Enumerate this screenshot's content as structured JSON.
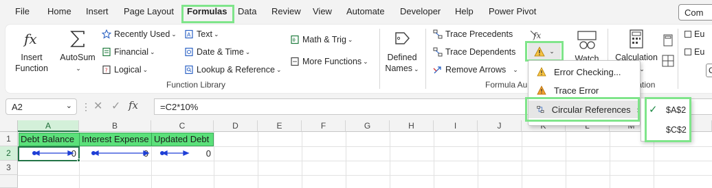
{
  "menu": {
    "tabs": [
      "File",
      "Home",
      "Insert",
      "Page Layout",
      "Formulas",
      "Data",
      "Review",
      "View",
      "Automate",
      "Developer",
      "Help",
      "Power Pivot"
    ],
    "active_tab": "Formulas",
    "comments_label": "Com"
  },
  "ribbon": {
    "insert_function": [
      "Insert",
      "Function"
    ],
    "autosum": "AutoSum",
    "recently_used": "Recently Used",
    "financial": "Financial",
    "logical": "Logical",
    "text": "Text",
    "date_time": "Date & Time",
    "lookup_reference": "Lookup & Reference",
    "math_trig": "Math & Trig",
    "more_functions": "More Functions",
    "function_library_label": "Function Library",
    "defined_names": [
      "Defined",
      "Names"
    ],
    "trace_precedents": "Trace Precedents",
    "trace_dependents": "Trace Dependents",
    "remove_arrows": "Remove Arrows",
    "formula_auditing_label": "Formula Au",
    "watch": "Watch",
    "calculation": "Calculation",
    "calculation_options_tail": "ns",
    "calculation_label": "ulation",
    "eu1": "Eu",
    "eu2": "Eu"
  },
  "error_dropdown": {
    "items": [
      "Error Checking...",
      "Trace Error",
      "Circular References"
    ]
  },
  "circular_submenu": {
    "items": [
      "$A$2",
      "$C$2"
    ]
  },
  "formula_bar": {
    "name_box": "A2",
    "formula": "=C2*10%"
  },
  "sheet": {
    "columns": [
      "A",
      "B",
      "C",
      "D",
      "E",
      "F",
      "G",
      "H",
      "I",
      "J",
      "K",
      "L",
      "M"
    ],
    "rows": [
      "1",
      "2",
      "3"
    ],
    "headers": [
      "Debt Balance",
      "Interest Expense",
      "Updated Debt"
    ],
    "values": [
      "0",
      "0",
      "0"
    ]
  },
  "colors": {
    "highlight": "#7fe58a",
    "header_fill": "#5be07a",
    "excel_green": "#217346",
    "trace_arrow": "#1f3fd6"
  }
}
